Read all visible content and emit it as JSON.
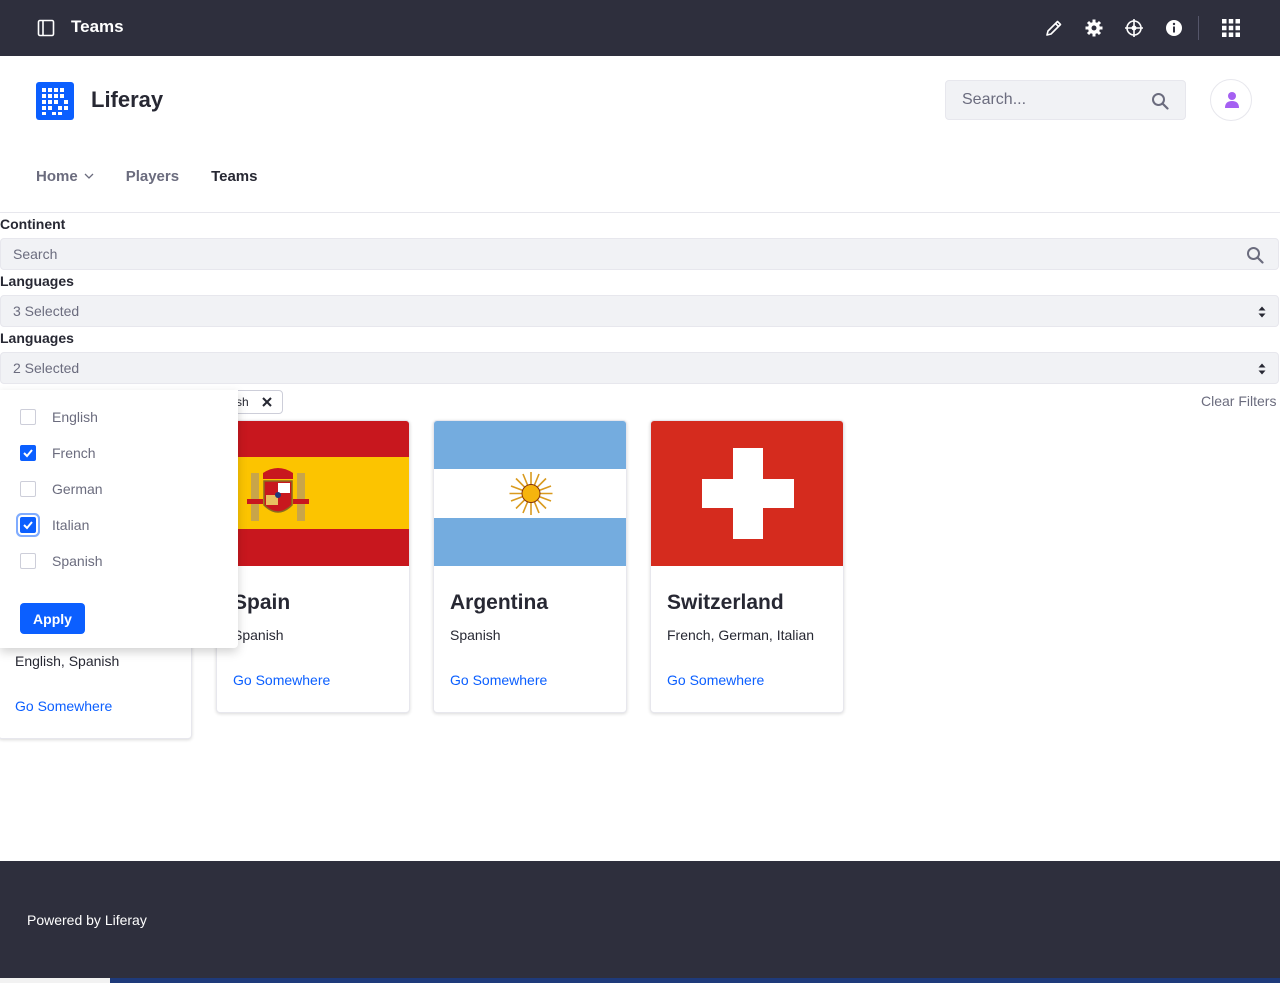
{
  "topbar": {
    "page_name": "Teams"
  },
  "header": {
    "site_name": "Liferay",
    "search_placeholder": "Search...",
    "nav": [
      {
        "label": "Home",
        "has_dropdown": true
      },
      {
        "label": "Players"
      },
      {
        "label": "Teams",
        "active": true
      }
    ]
  },
  "filters": {
    "continent_label": "Continent",
    "continent_placeholder": "Search",
    "languages_label_1": "Languages",
    "languages_value_1": "3 Selected",
    "languages_label_2": "Languages",
    "languages_value_2": "2 Selected",
    "chip_text": "sh",
    "clear_filters": "Clear Filters"
  },
  "dropdown": {
    "options": [
      {
        "label": "English",
        "checked": false
      },
      {
        "label": "French",
        "checked": true
      },
      {
        "label": "German",
        "checked": false
      },
      {
        "label": "Italian",
        "checked": true
      },
      {
        "label": "Spanish",
        "checked": false
      }
    ],
    "apply_label": "Apply"
  },
  "cards": [
    {
      "title": "",
      "languages": "English, Spanish",
      "link": "Go Somewhere"
    },
    {
      "title": "Spain",
      "languages": "Spanish",
      "link": "Go Somewhere"
    },
    {
      "title": "Argentina",
      "languages": "Spanish",
      "link": "Go Somewhere"
    },
    {
      "title": "Switzerland",
      "languages": "French, German, Italian",
      "link": "Go Somewhere"
    }
  ],
  "footer": {
    "text": "Powered by Liferay"
  },
  "colors": {
    "accent": "#0b5fff",
    "topbar": "#2e2f3d",
    "spain_red": "#c8171e",
    "spain_yellow": "#fcc400",
    "argentina_blue": "#74acdf",
    "swiss_red": "#d52b1e"
  }
}
